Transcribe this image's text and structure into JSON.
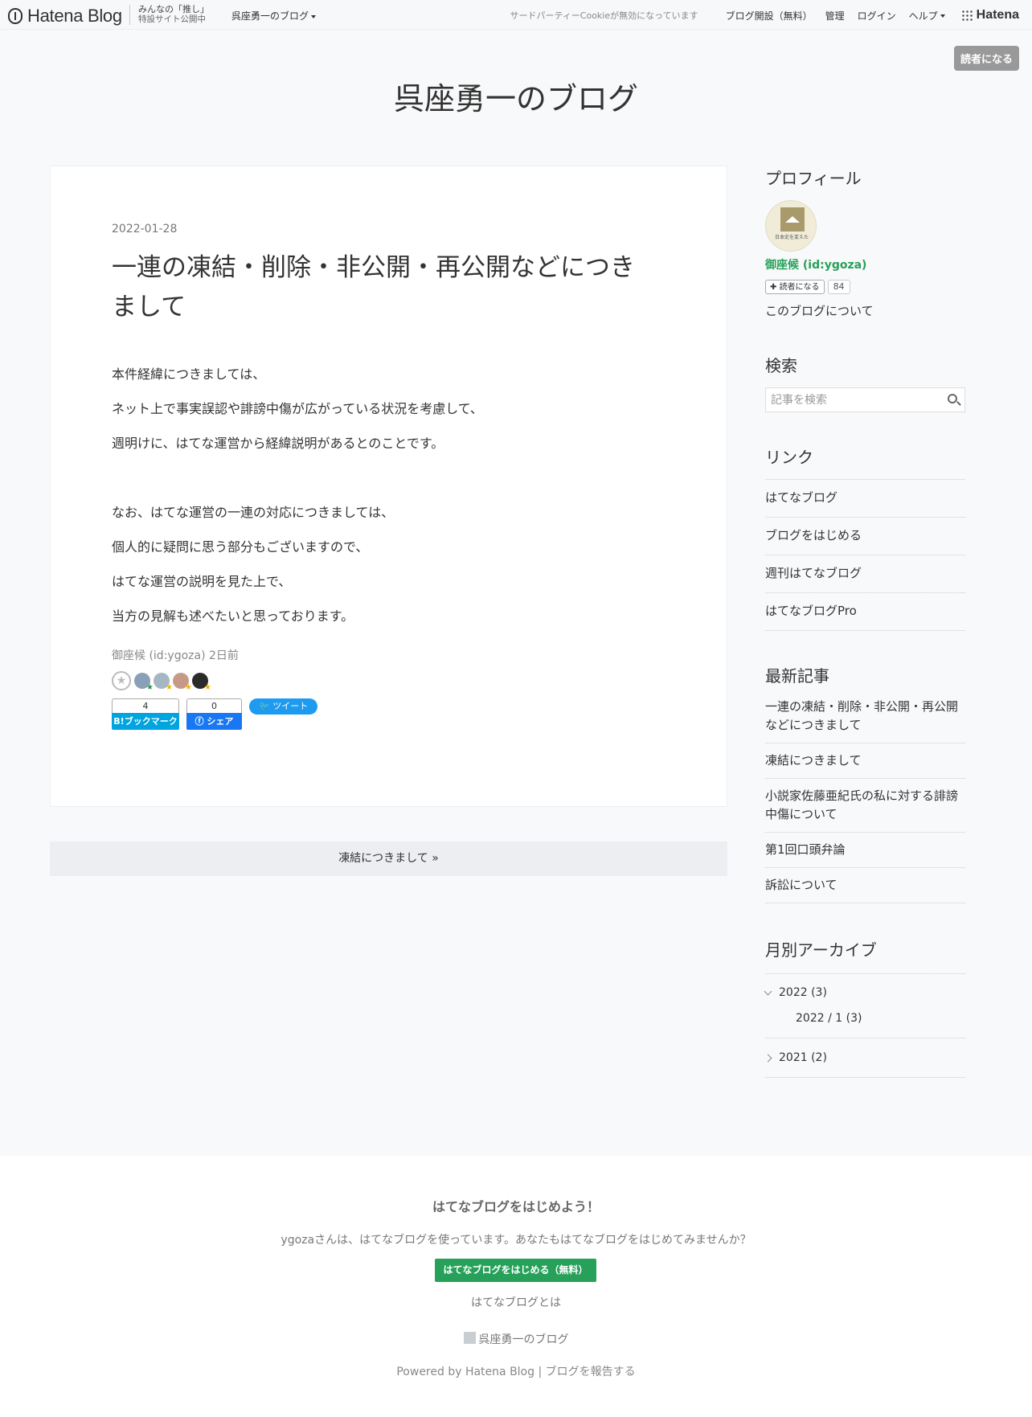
{
  "header": {
    "logo_text": "Hatena Blog",
    "promo_line1": "みんなの「推し」",
    "promo_line2": "特設サイト公開中",
    "blog_menu": "呉座勇一のブログ",
    "cookie_notice": "サードパーティーCookieが無効になっています",
    "create_blog": "ブログ開設（無料）",
    "admin": "管理",
    "login": "ログイン",
    "help": "ヘルプ",
    "hatena": "Hatena"
  },
  "subscribe_top": "読者になる",
  "blog_title": "呉座勇一のブログ",
  "entry": {
    "date": "2022-01-28",
    "title": "一連の凍結・削除・非公開・再公開などにつきまして",
    "paragraphs": [
      "本件経緯につきましては、",
      "ネット上で事実誤認や誹謗中傷が広がっている状況を考慮して、",
      "週明けに、はてな運営から経緯説明があるとのことです。",
      "",
      "なお、はてな運営の一連の対応につきましては、",
      "個人的に疑問に思う部分もございますので、",
      "はてな運営の説明を見た上で、",
      "当方の見解も述べたいと思っております。"
    ],
    "author_line": "御座候 (id:ygoza) 2日前",
    "bookmark_count": "4",
    "bookmark_label": "B!ブックマーク",
    "fb_count": "0",
    "fb_label": "シェア",
    "tweet_label": "ツイート"
  },
  "pager": {
    "next": "凍結につきまして »"
  },
  "sidebar": {
    "profile_title": "プロフィール",
    "avatar_text": "日本史を変えた",
    "profile_name": "御座候 (id:ygoza)",
    "reader_button": "読者になる",
    "reader_count": "84",
    "about": "このブログについて",
    "search_title": "検索",
    "search_placeholder": "記事を検索",
    "links_title": "リンク",
    "links": [
      "はてなブログ",
      "ブログをはじめる",
      "週刊はてなブログ",
      "はてなブログPro"
    ],
    "recent_title": "最新記事",
    "recent": [
      "一連の凍結・削除・非公開・再公開などにつきまして",
      "凍結につきまして",
      "小説家佐藤亜紀氏の私に対する誹謗中傷について",
      "第1回口頭弁論",
      "訴訟について"
    ],
    "archive_title": "月別アーカイブ",
    "archive": {
      "year1": "2022 (3)",
      "month1": "2022 / 1 (3)",
      "year2": "2021 (2)"
    }
  },
  "footer": {
    "heading": "はてなブログをはじめよう！",
    "desc": "ygozaさんは、はてなブログを使っています。あなたもはてなブログをはじめてみませんか？",
    "cta": "はてなブログをはじめる（無料）",
    "what": "はてなブログとは",
    "blog_name": "呉座勇一のブログ",
    "powered": "Powered by Hatena Blog",
    "report": "ブログを報告する"
  },
  "colors": {
    "accent_green": "#27a15a",
    "bookmark_blue": "#00a4de",
    "facebook_blue": "#1877f2",
    "twitter_blue": "#1d9bf0"
  }
}
